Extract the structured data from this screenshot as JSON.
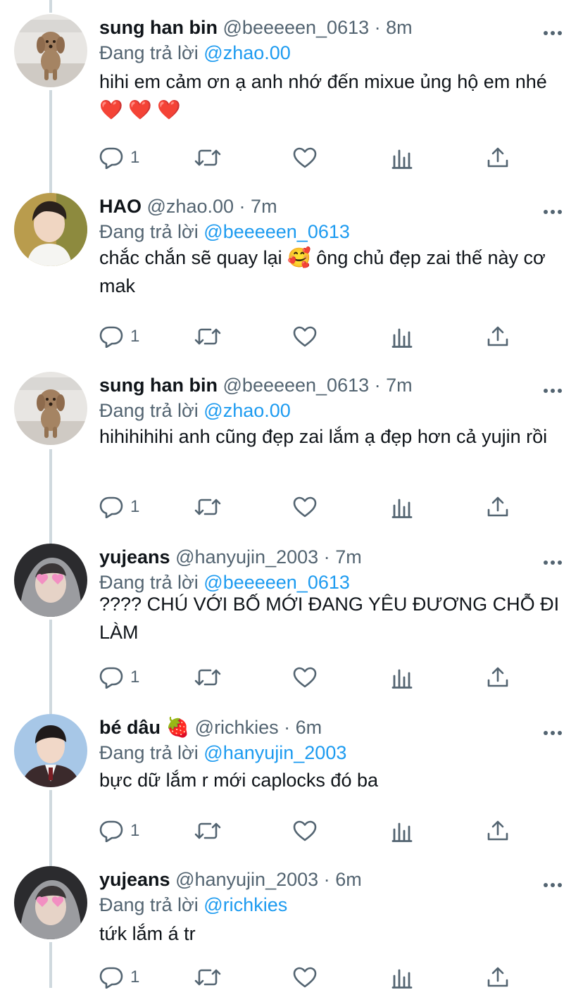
{
  "reply_prefix": "Đang trả lời",
  "separator": "·",
  "tweets": [
    {
      "name": "sung han bin",
      "handle": "@beeeeen_0613",
      "time": "8m",
      "reply_to": "@zhao.00",
      "text": "hihi em cảm ơn ạ anh nhớ đến mixue ủng hộ em nhé ❤️ ❤️ ❤️",
      "reply_count": "1",
      "avatar": "poodle-dog-photo"
    },
    {
      "name": "HAO",
      "handle": "@zhao.00",
      "time": "7m",
      "reply_to": "@beeeeen_0613",
      "text": "chắc chắn sẽ quay lại 🥰  ông chủ đẹp zai thế này cơ mak",
      "reply_count": "1",
      "avatar": "young-man-photo"
    },
    {
      "name": "sung han bin",
      "handle": "@beeeeen_0613",
      "time": "7m",
      "reply_to": "@zhao.00",
      "text": "hihihihihi anh cũng đẹp zai lắm ạ đẹp hơn cả yujin rồi",
      "reply_count": "1",
      "avatar": "poodle-dog-photo"
    },
    {
      "name": "yujeans",
      "handle": "@hanyujin_2003",
      "time": "7m",
      "reply_to": "@beeeeen_0613",
      "text": "???? CHÚ VỚI BỐ MỚI ĐANG YÊU ĐƯƠNG CHỖ ĐI LÀM",
      "reply_count": "1",
      "avatar": "boy-heart-glasses-photo"
    },
    {
      "name": "bé dâu 🍓",
      "handle": "@richkies",
      "time": "6m",
      "reply_to": "@hanyujin_2003",
      "text": "bực dữ lắm r mới caplocks đó ba",
      "reply_count": "1",
      "avatar": "boy-school-uniform-photo"
    },
    {
      "name": "yujeans",
      "handle": "@hanyujin_2003",
      "time": "6m",
      "reply_to": "@richkies",
      "text": "tứk lắm á tr",
      "reply_count": "1",
      "avatar": "boy-heart-glasses-photo"
    }
  ],
  "colors": {
    "link": "#1d9bf0",
    "secondary_text": "#536471",
    "thread_line": "#cfd9de"
  }
}
